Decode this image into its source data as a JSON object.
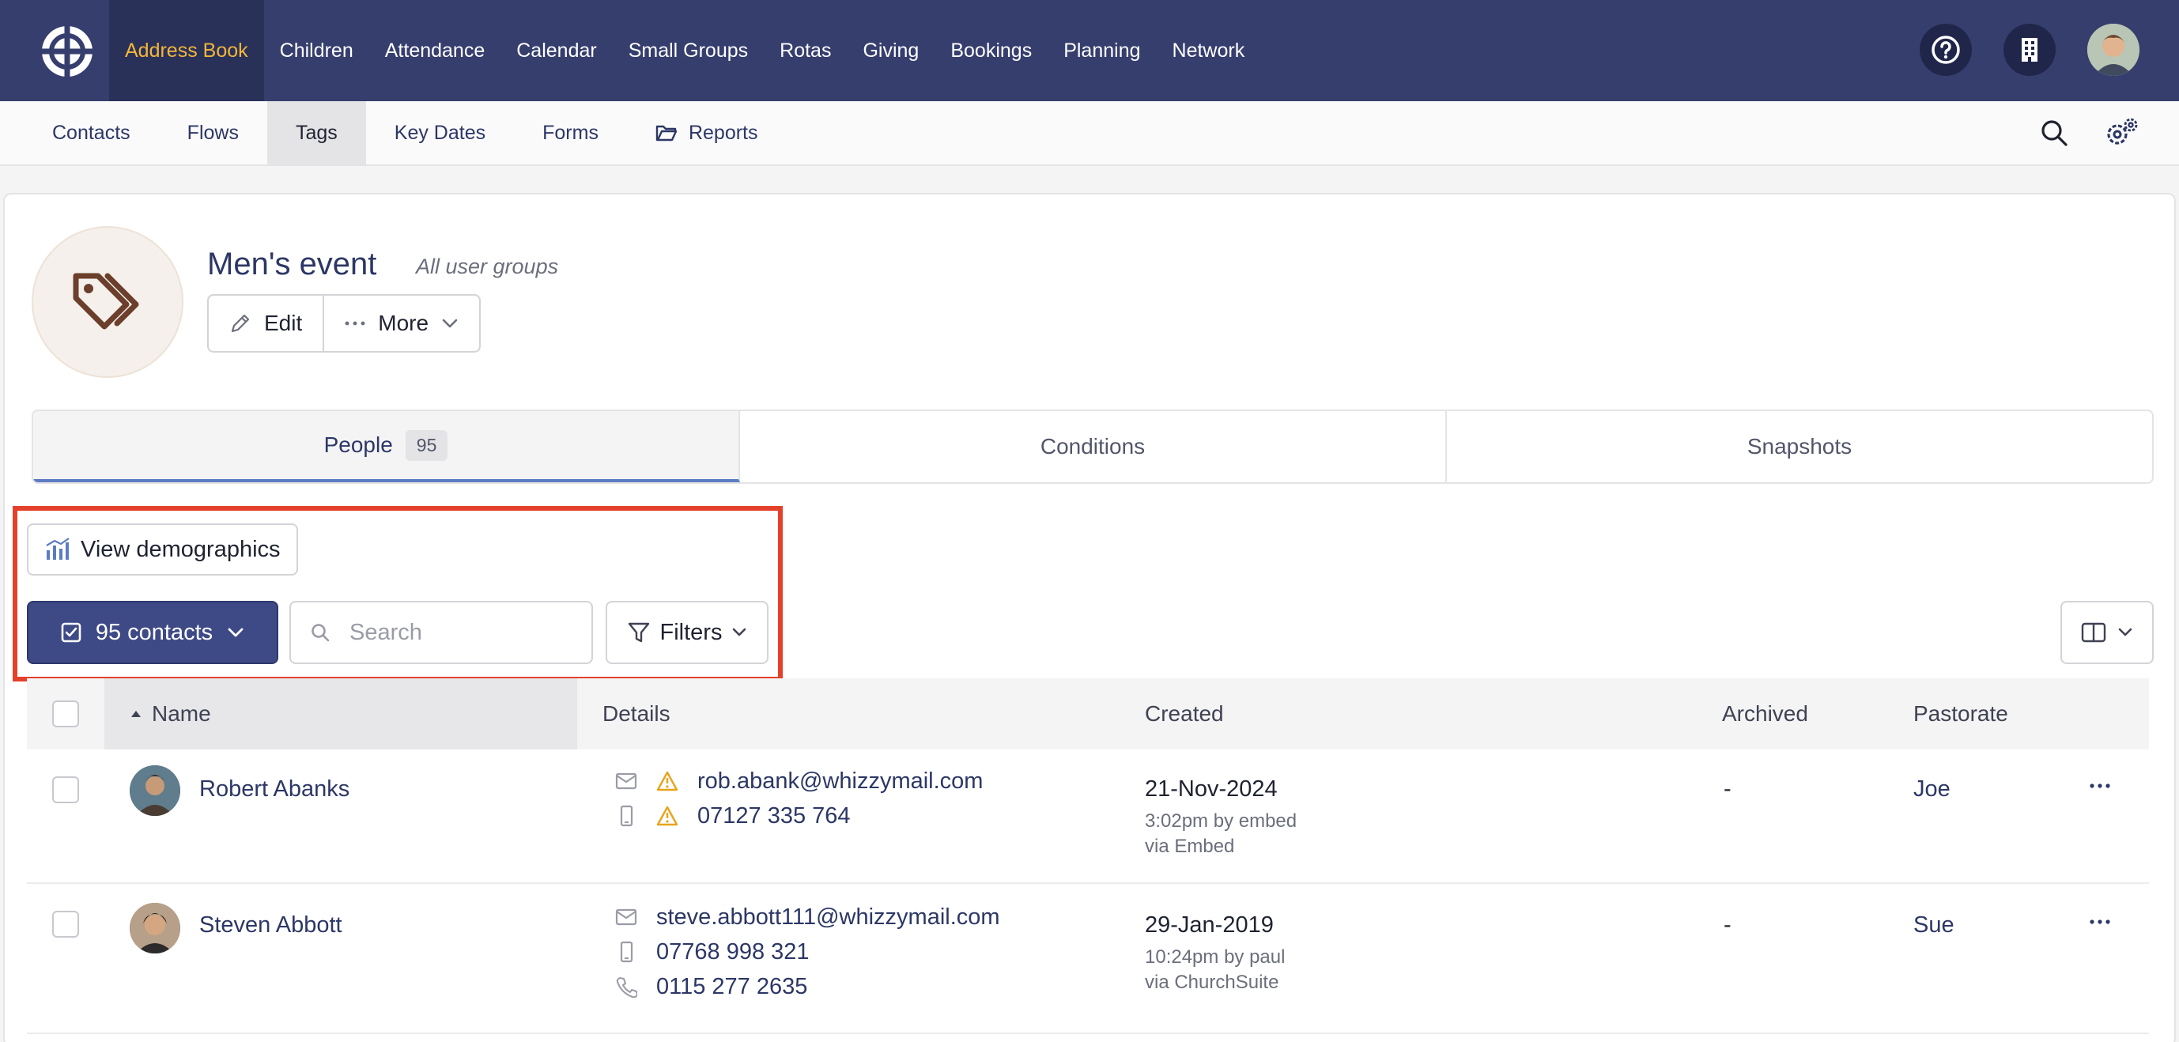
{
  "topnav": {
    "items": [
      {
        "label": "Address Book",
        "active": true
      },
      {
        "label": "Children"
      },
      {
        "label": "Attendance"
      },
      {
        "label": "Calendar"
      },
      {
        "label": "Small Groups"
      },
      {
        "label": "Rotas"
      },
      {
        "label": "Giving"
      },
      {
        "label": "Bookings"
      },
      {
        "label": "Planning"
      },
      {
        "label": "Network"
      }
    ],
    "icons": [
      "help-icon",
      "building-icon",
      "user-avatar"
    ]
  },
  "subnav": {
    "items": [
      {
        "label": "Contacts"
      },
      {
        "label": "Flows"
      },
      {
        "label": "Tags",
        "active": true
      },
      {
        "label": "Key Dates"
      },
      {
        "label": "Forms"
      },
      {
        "label": "Reports",
        "icon": "folder-icon"
      }
    ],
    "icons": [
      "search-icon",
      "settings-icon"
    ]
  },
  "tag": {
    "title": "Men's event",
    "subtitle": "All user groups",
    "edit_label": "Edit",
    "more_label": "More"
  },
  "tabs": [
    {
      "label": "People",
      "count": "95",
      "active": true
    },
    {
      "label": "Conditions"
    },
    {
      "label": "Snapshots"
    }
  ],
  "toolbar": {
    "demographics_label": "View demographics",
    "contacts_label": "95 contacts",
    "search_placeholder": "Search",
    "filters_label": "Filters"
  },
  "table": {
    "headers": {
      "name": "Name",
      "details": "Details",
      "created": "Created",
      "archived": "Archived",
      "pastorate": "Pastorate"
    },
    "rows": [
      {
        "name": "Robert Abanks",
        "email": "rob.abank@whizzymail.com",
        "mobile": "07127 335 764",
        "warning": true,
        "created_date": "21-Nov-2024",
        "created_by": "3:02pm by embed",
        "created_via": "via Embed",
        "archived": "-",
        "pastorate": "Joe"
      },
      {
        "name": "Steven Abbott",
        "email": "steve.abbott111@whizzymail.com",
        "mobile": "07768 998 321",
        "phone": "0115 277 2635",
        "warning": false,
        "created_date": "29-Jan-2019",
        "created_by": "10:24pm by paul",
        "created_via": "via ChurchSuite",
        "archived": "-",
        "pastorate": "Sue"
      }
    ]
  },
  "colors": {
    "nav_bg": "#363e6e",
    "nav_active_text": "#f3b63a",
    "primary": "#3e4a86",
    "highlight_border": "#e3412b",
    "warning": "#e8a319"
  }
}
